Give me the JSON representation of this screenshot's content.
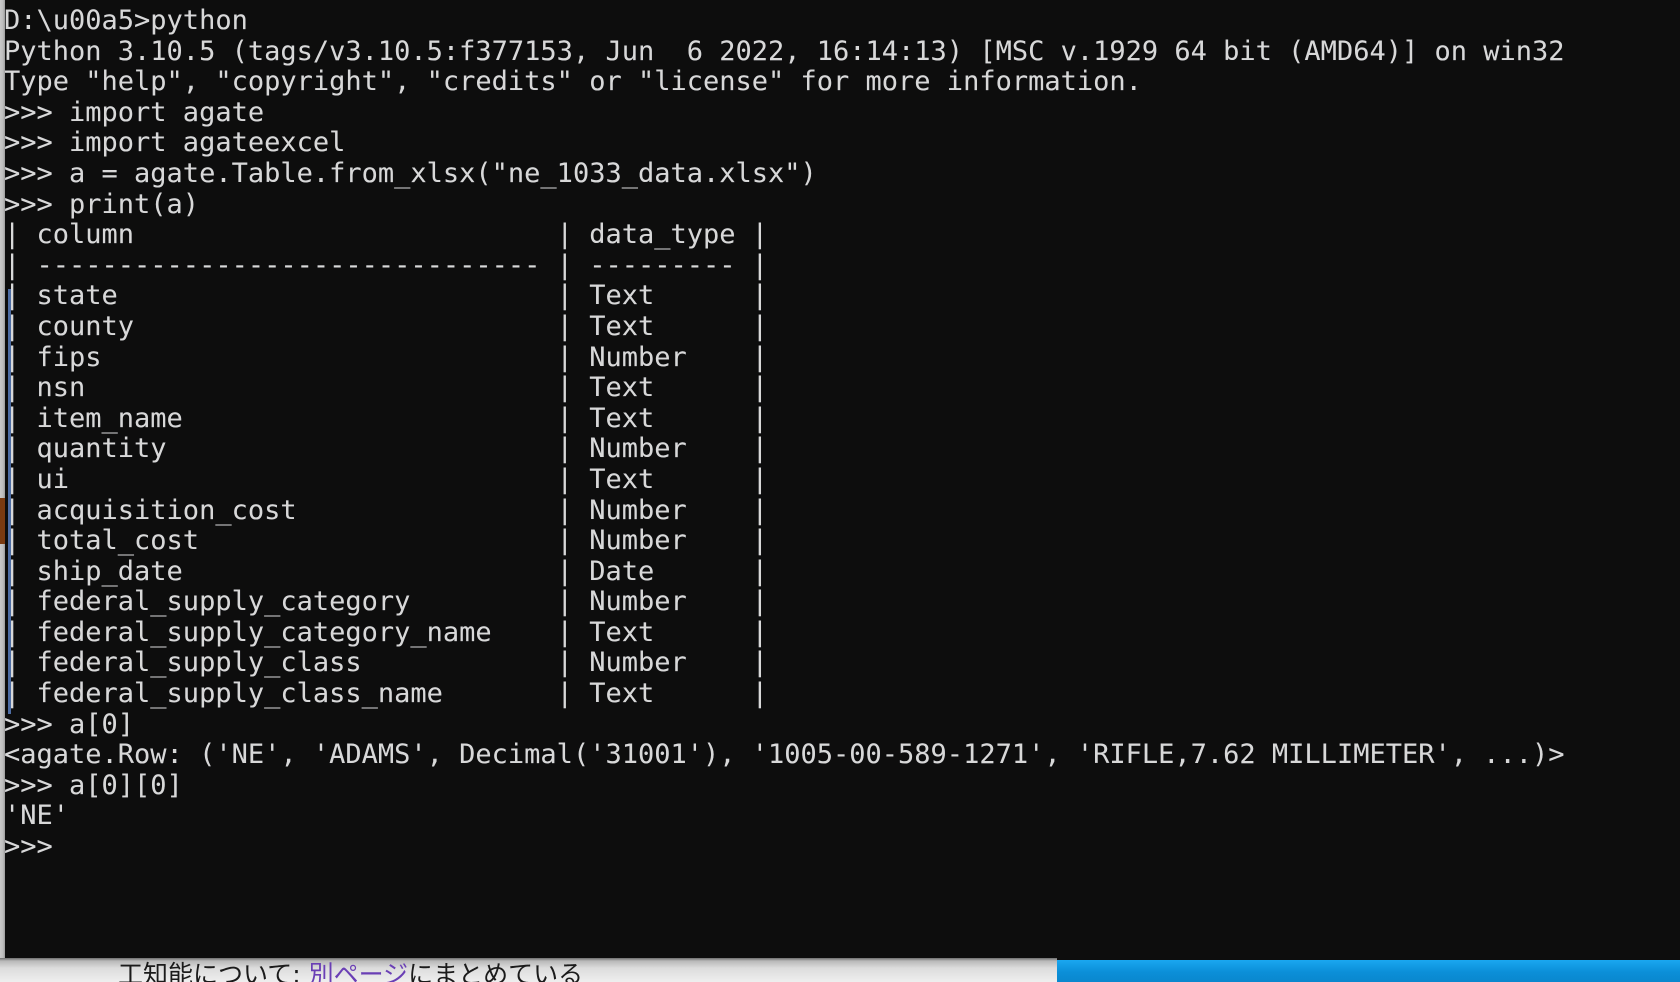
{
  "window": {
    "kind": "windows-command-prompt",
    "background_color": "#0d0d0d",
    "foreground_color": "#d8d8d8"
  },
  "console": {
    "lines": [
      "D:\\u00a5>python",
      "Python 3.10.5 (tags/v3.10.5:f377153, Jun  6 2022, 16:14:13) [MSC v.1929 64 bit (AMD64)] on win32",
      "Type \"help\", \"copyright\", \"credits\" or \"license\" for more information.",
      ">>> import agate",
      ">>> import agateexcel",
      ">>> a = agate.Table.from_xlsx(\"ne_1033_data.xlsx\")",
      ">>> print(a)",
      "| column                          | data_type |",
      "| ------------------------------- | --------- |",
      "| state                           | Text      |",
      "| county                          | Text      |",
      "| fips                            | Number    |",
      "| nsn                             | Text      |",
      "| item_name                       | Text      |",
      "| quantity                        | Number    |",
      "| ui                              | Text      |",
      "| acquisition_cost                | Number    |",
      "| total_cost                      | Number    |",
      "| ship_date                       | Date      |",
      "| federal_supply_category         | Number    |",
      "| federal_supply_category_name    | Text      |",
      "| federal_supply_class            | Number    |",
      "| federal_supply_class_name       | Text      |",
      "",
      ">>> a[0]",
      "<agate.Row: ('NE', 'ADAMS', Decimal('31001'), '1005-00-589-1271', 'RIFLE,7.62 MILLIMETER', ...)>",
      ">>> a[0][0]",
      "'NE'",
      ">>> "
    ],
    "prompt_symbol": ">>>",
    "shell_prompt": "D:\\u00a5>",
    "command_python": "python",
    "python_version_line": "Python 3.10.5 (tags/v3.10.5:f377153, Jun  6 2022, 16:14:13) [MSC v.1929 64 bit (AMD64)] on win32",
    "help_line": "Type \"help\", \"copyright\", \"credits\" or \"license\" for more information."
  },
  "table": {
    "headers": [
      "column",
      "data_type"
    ],
    "rows": [
      {
        "column": "state",
        "data_type": "Text"
      },
      {
        "column": "county",
        "data_type": "Text"
      },
      {
        "column": "fips",
        "data_type": "Number"
      },
      {
        "column": "nsn",
        "data_type": "Text"
      },
      {
        "column": "item_name",
        "data_type": "Text"
      },
      {
        "column": "quantity",
        "data_type": "Number"
      },
      {
        "column": "ui",
        "data_type": "Text"
      },
      {
        "column": "acquisition_cost",
        "data_type": "Number"
      },
      {
        "column": "total_cost",
        "data_type": "Number"
      },
      {
        "column": "ship_date",
        "data_type": "Date"
      },
      {
        "column": "federal_supply_category",
        "data_type": "Number"
      },
      {
        "column": "federal_supply_category_name",
        "data_type": "Text"
      },
      {
        "column": "federal_supply_class",
        "data_type": "Number"
      },
      {
        "column": "federal_supply_class_name",
        "data_type": "Text"
      }
    ]
  },
  "row_output": {
    "expression": ">>> a[0]",
    "value": "<agate.Row: ('NE', 'ADAMS', Decimal('31001'), '1005-00-589-1271', 'RIFLE,7.62 MILLIMETER', ...)>",
    "expression2": ">>> a[0][0]",
    "value2": "'NE'"
  },
  "background_page": {
    "text_before_link": "工知能について: ",
    "link_text": "別ページ",
    "text_after_link": "にまとめている",
    "link_color": "#6a3fb5"
  },
  "taskbar": {
    "accent_color": "#0b8fd8"
  }
}
